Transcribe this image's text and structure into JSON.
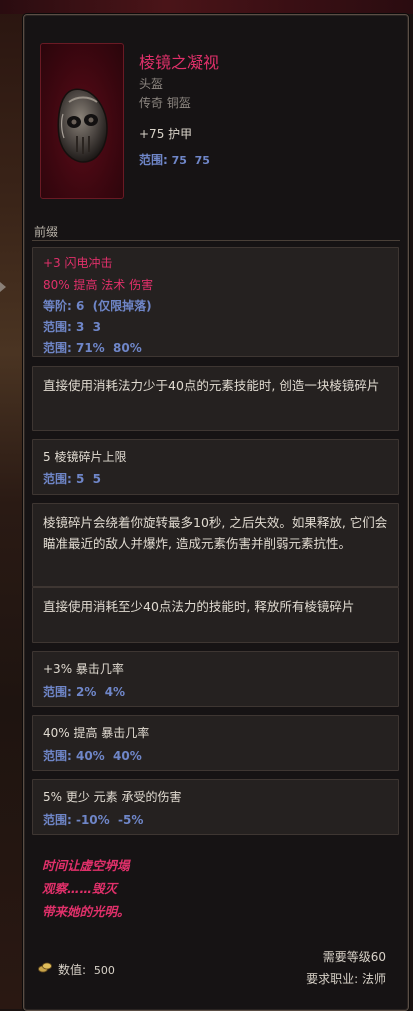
{
  "item": {
    "name": "棱镜之凝视",
    "type": "头盔",
    "rarity": "传奇 铜盔",
    "armor": "+75 护甲",
    "armor_range_label": "范围:",
    "armor_range": "75  75"
  },
  "prefix_label": "前缀",
  "affixes": [
    {
      "lines": [
        {
          "text": "+3 闪电冲击",
          "style": "red"
        },
        {
          "text": "80% 提高 法术 伤害",
          "style": "red"
        },
        {
          "text": "等阶: 6  (仅限掉落)",
          "style": "blue"
        },
        {
          "text": "范围: 3  3",
          "style": "blue"
        },
        {
          "text": "范围: 71%  80%",
          "style": "blue"
        }
      ]
    },
    {
      "paragraph": "直接使用消耗法力少于40点的元素技能时, 创造一块棱镜碎片"
    },
    {
      "lines": [
        {
          "text": "5 棱镜碎片上限",
          "style": "white"
        },
        {
          "text": "范围: 5  5",
          "style": "blue"
        }
      ]
    },
    {
      "paragraph": "棱镜碎片会绕着你旋转最多10秒, 之后失效。如果释放, 它们会瞄准最近的敌人并爆炸, 造成元素伤害并削弱元素抗性。"
    },
    {
      "paragraph": "直接使用消耗至少40点法力的技能时, 释放所有棱镜碎片"
    },
    {
      "lines": [
        {
          "text": "+3% 暴击几率",
          "style": "white"
        },
        {
          "text": "范围: 2%  4%",
          "style": "blue"
        }
      ]
    },
    {
      "lines": [
        {
          "text": "40% 提高 暴击几率",
          "style": "white"
        },
        {
          "text": "范围: 40%  40%",
          "style": "blue"
        }
      ]
    },
    {
      "lines": [
        {
          "text": "5% 更少 元素 承受的伤害",
          "style": "white"
        },
        {
          "text": "范围: -10%  -5%",
          "style": "blue"
        }
      ]
    }
  ],
  "flavor_text": [
    "时间让虚空坍塌",
    "观察……毁灭",
    "带来她的光明。"
  ],
  "footer": {
    "value_label": "数值:",
    "value": "500",
    "level_req": "需要等级60",
    "class_req": "要求职业: 法师"
  },
  "colors": {
    "unique": "#e0306a",
    "range": "#6f86c8",
    "panel_bg": "#161314",
    "box_bg": "#252120"
  },
  "icons": [
    "helmet-icon",
    "coin-icon",
    "arrow-icon"
  ]
}
